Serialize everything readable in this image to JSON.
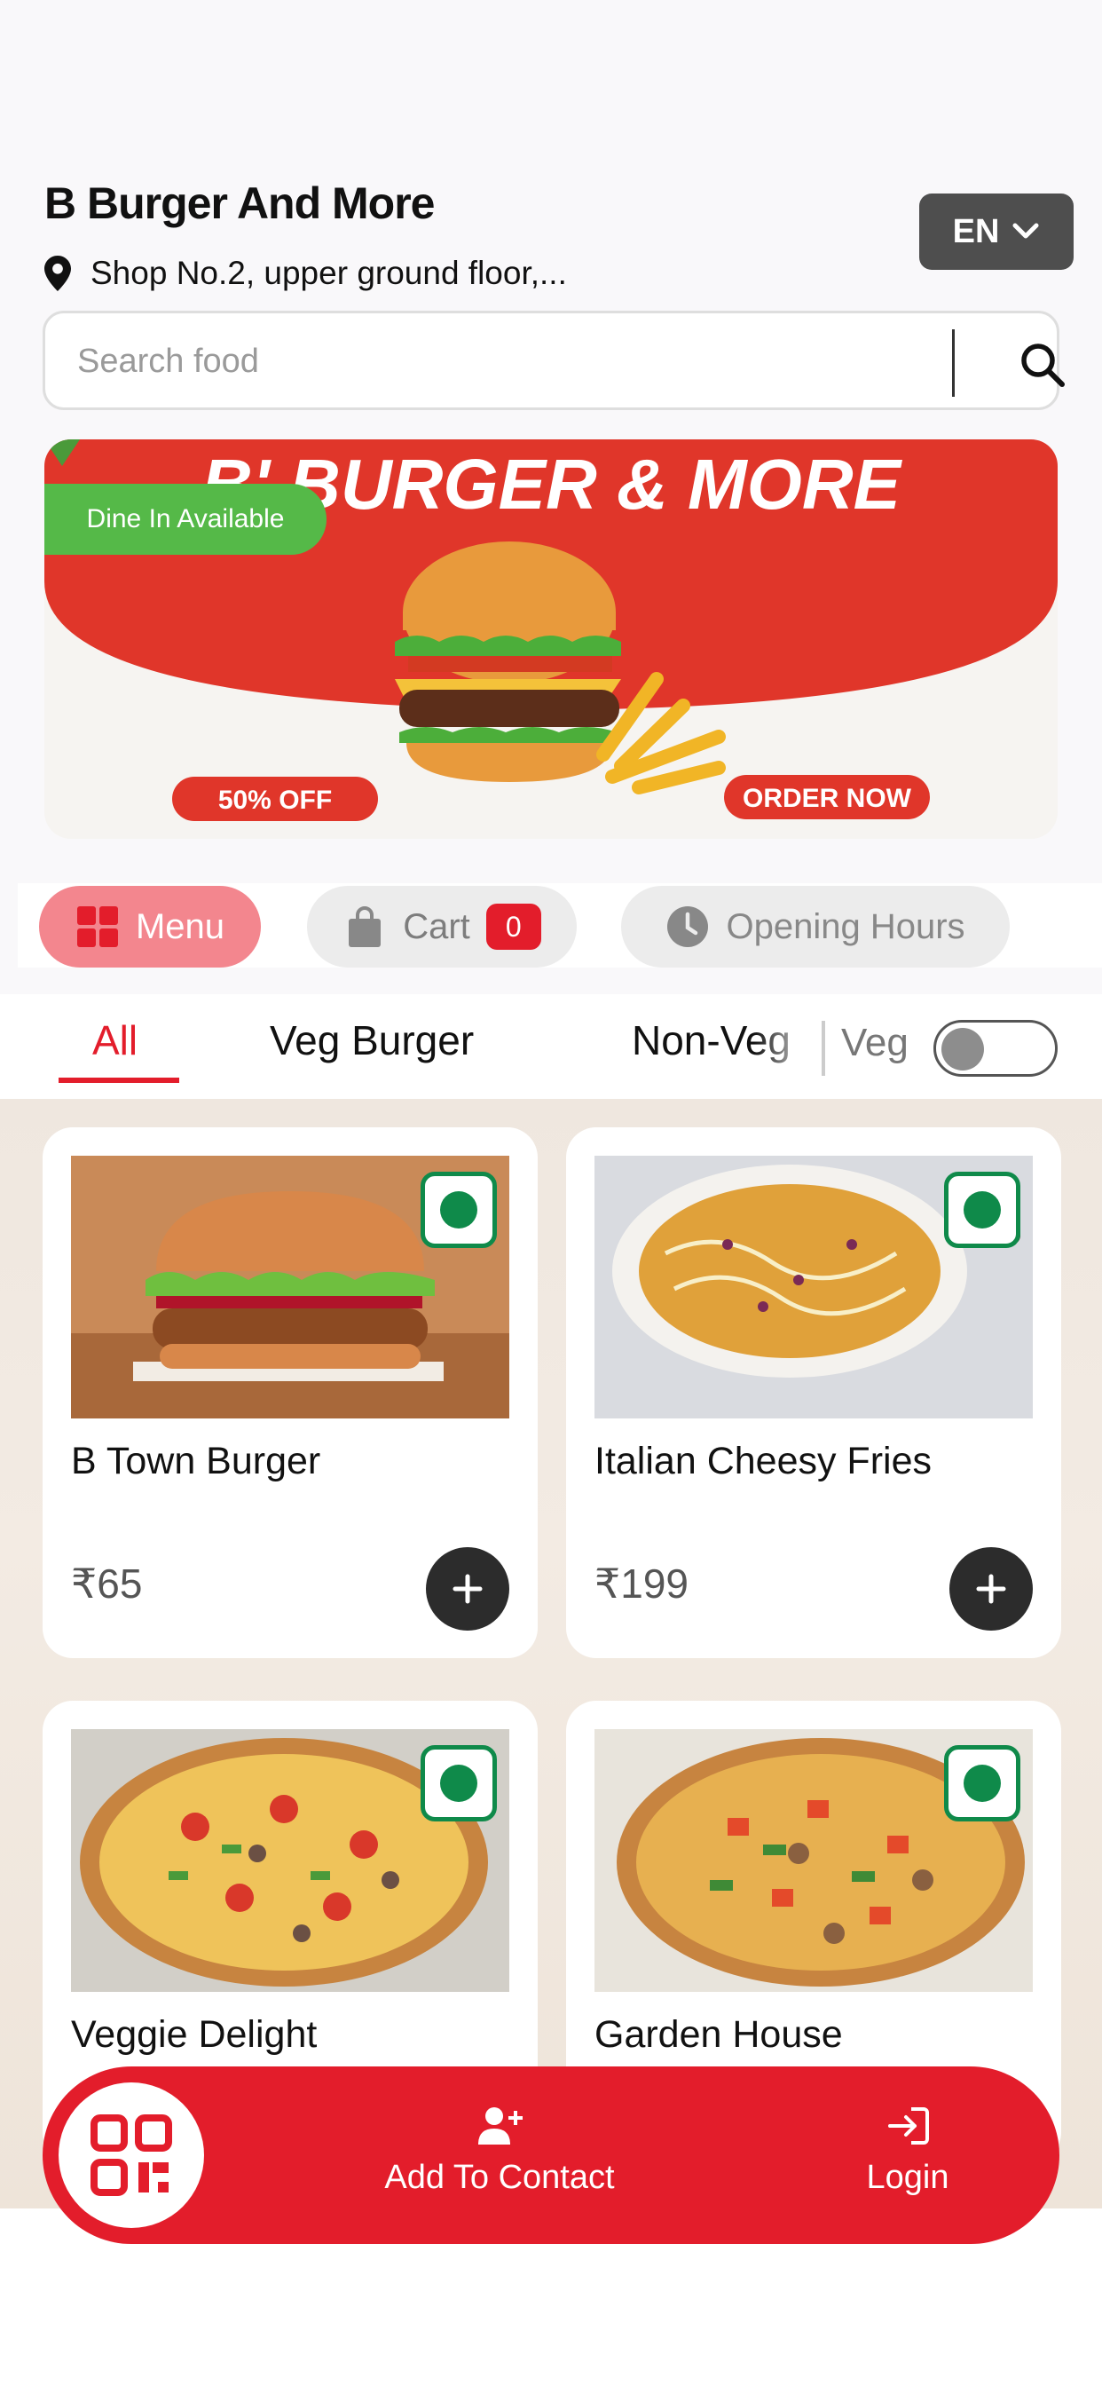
{
  "shop": {
    "name": "B Burger And More",
    "address": "Shop No.2, upper ground floor,..."
  },
  "language": {
    "selected": "EN"
  },
  "search": {
    "placeholder": "Search food"
  },
  "banner": {
    "badge": "Dine In Available",
    "headline": "B' BURGER & MORE",
    "offer": "50% OFF",
    "cta": "ORDER NOW"
  },
  "tabs": {
    "menu": "Menu",
    "cart": "Cart",
    "cart_count": "0",
    "hours": "Opening Hours"
  },
  "categories": {
    "all": "All",
    "veg_burger": "Veg Burger",
    "non_veg": "Non-Veg",
    "veg_filter_label": "Veg",
    "veg_filter_on": false
  },
  "products": [
    {
      "name": "B Town Burger",
      "price": "₹65"
    },
    {
      "name": "Italian Cheesy Fries",
      "price": "₹199"
    },
    {
      "name": "Veggie Delight",
      "price": ""
    },
    {
      "name": "Garden House",
      "price": ""
    }
  ],
  "bottom_bar": {
    "contact": "Add To Contact",
    "login": "Login"
  },
  "colors": {
    "brand_red": "#e31d2b",
    "veg_green": "#0f8a4a",
    "menu_pill": "#f3868e",
    "badge_green": "#55b948"
  },
  "icons": [
    "location-pin-icon",
    "chevron-down-icon",
    "search-icon",
    "grid-icon",
    "bag-icon",
    "clock-icon",
    "plus-icon",
    "qr-code-icon",
    "add-user-icon",
    "login-icon"
  ]
}
